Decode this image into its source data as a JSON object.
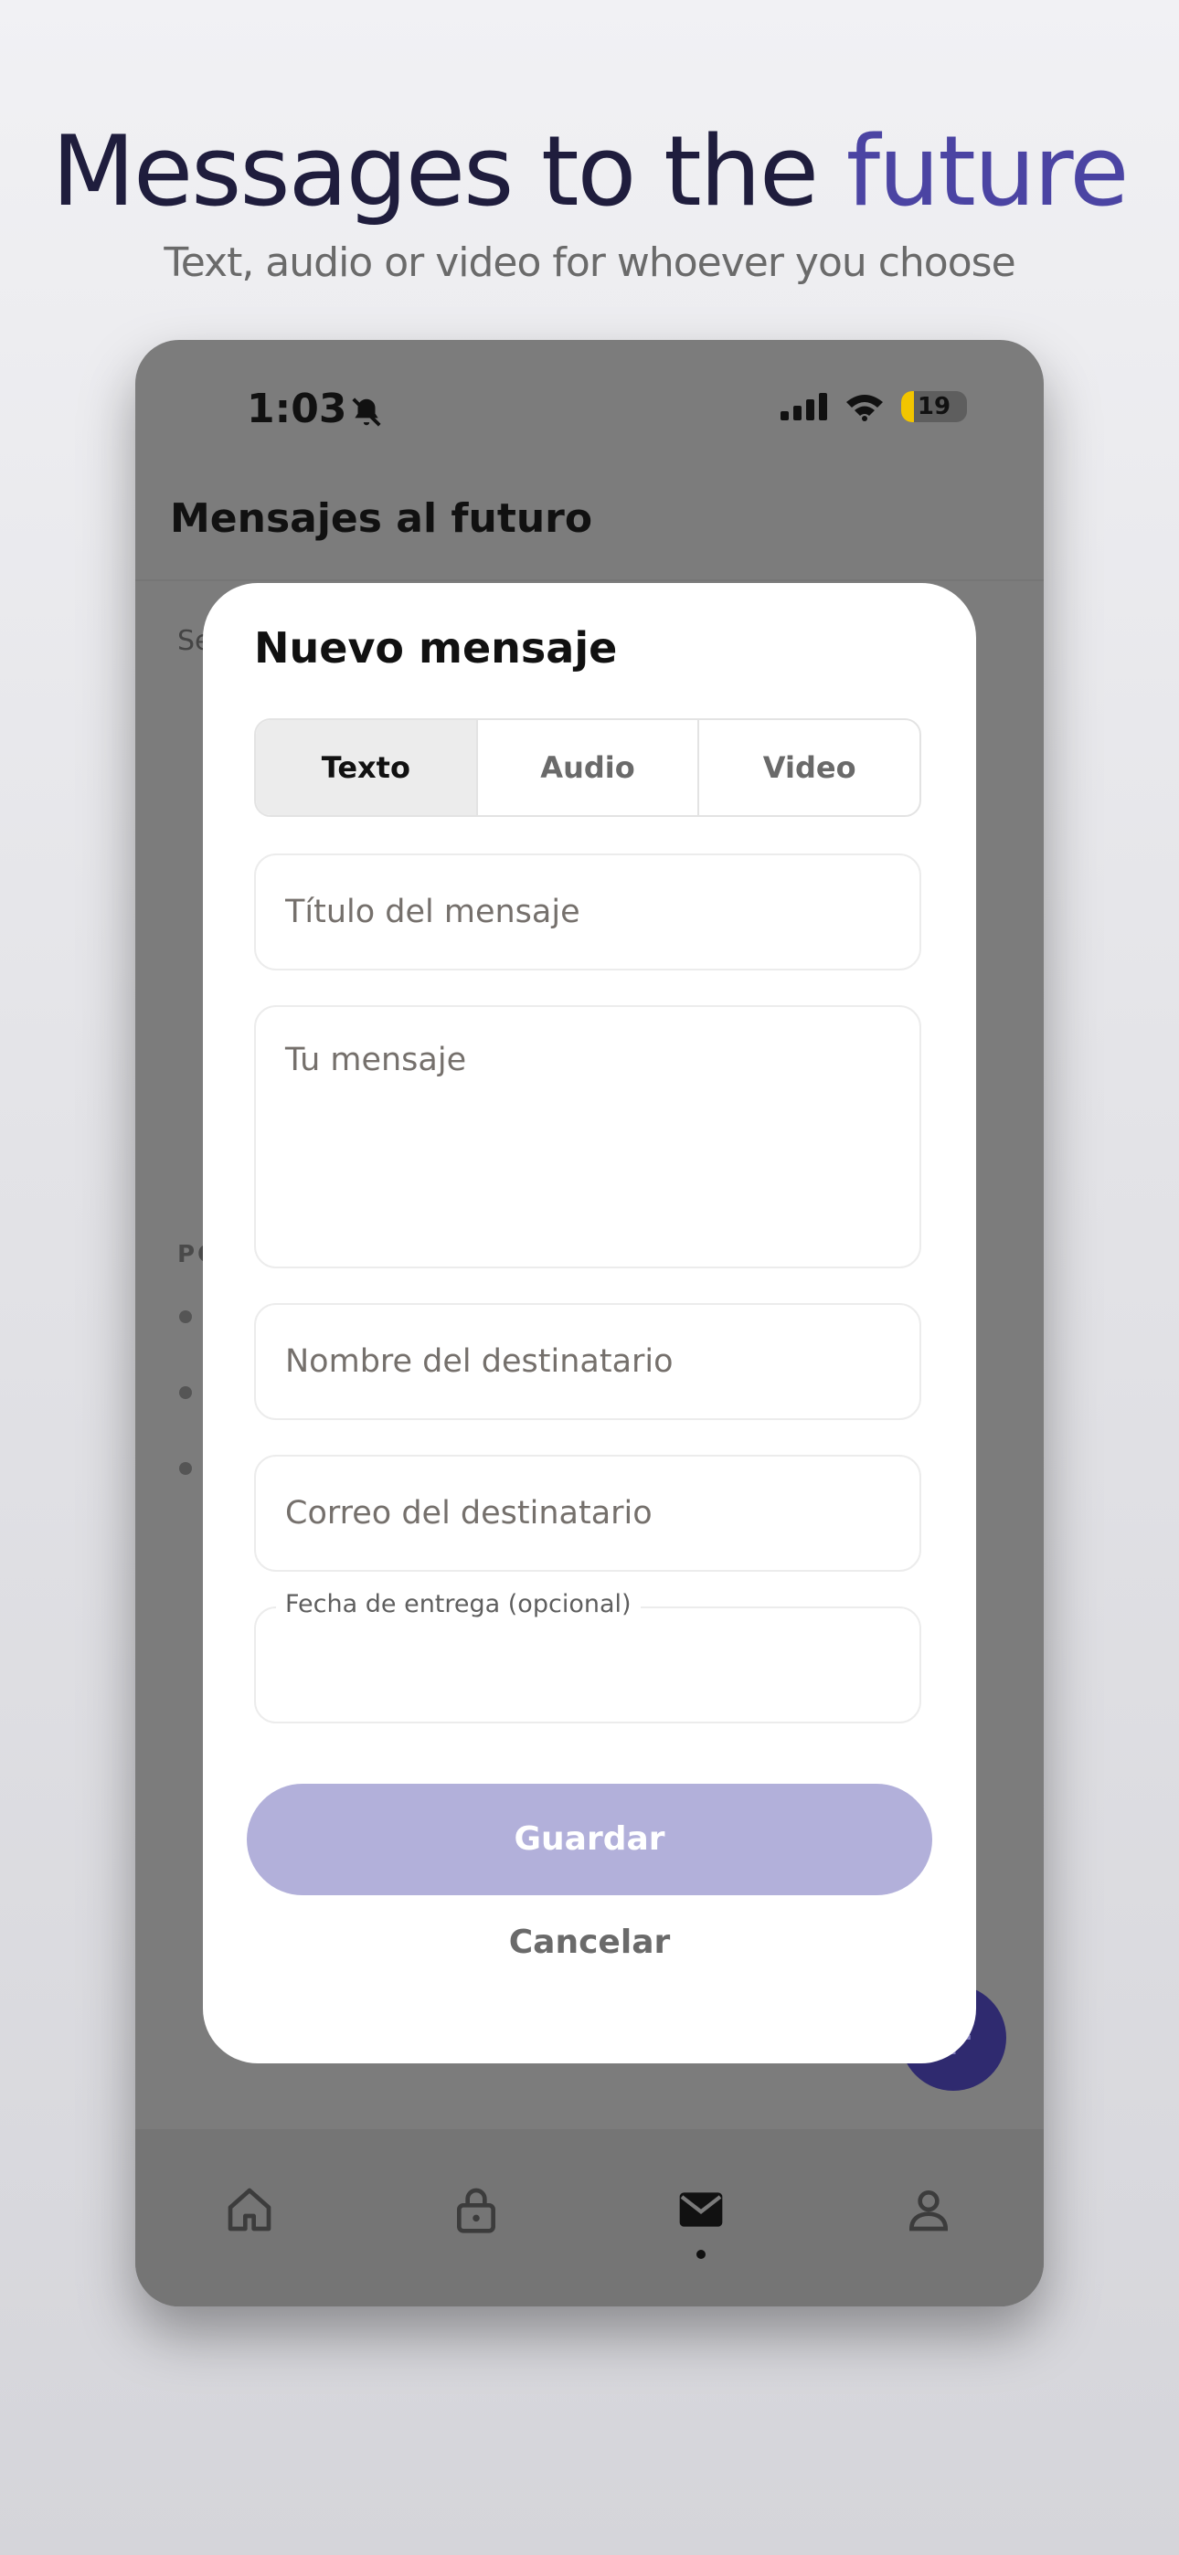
{
  "promo": {
    "headline_main": "Messages to the",
    "headline_accent": "future",
    "subheadline": "Text, audio or video for whoever you choose"
  },
  "status_bar": {
    "time": "1:03",
    "battery": "19"
  },
  "app": {
    "title": "Mensajes al futuro",
    "intro_peek": "Se qu",
    "section_peek": "PC"
  },
  "modal": {
    "title": "Nuevo mensaje",
    "tabs": [
      {
        "label": "Texto",
        "active": true
      },
      {
        "label": "Audio",
        "active": false
      },
      {
        "label": "Video",
        "active": false
      }
    ],
    "fields": {
      "title_placeholder": "Título del mensaje",
      "message_placeholder": "Tu mensaje",
      "recipient_name_placeholder": "Nombre del destinatario",
      "recipient_email_placeholder": "Correo del destinatario",
      "delivery_date_label": "Fecha de entrega (opcional)"
    },
    "save_label": "Guardar",
    "cancel_label": "Cancelar"
  },
  "fab": {
    "label": "+"
  },
  "nav": {
    "items": [
      {
        "icon": "home-icon",
        "active": false
      },
      {
        "icon": "lock-icon",
        "active": false
      },
      {
        "icon": "mail-icon",
        "active": true
      },
      {
        "icon": "profile-icon",
        "active": false
      }
    ]
  },
  "colors": {
    "accent": "#4b44a3",
    "headline_dark": "#1f1d3d",
    "save_disabled": "#b2b0da"
  }
}
